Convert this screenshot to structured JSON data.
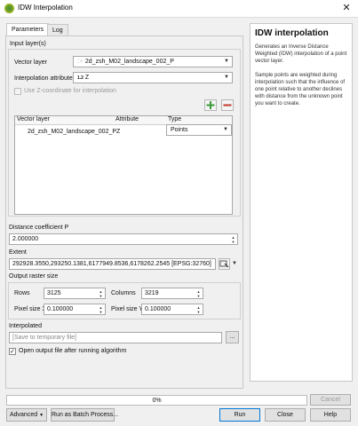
{
  "window": {
    "title": "IDW Interpolation",
    "close_icon": "close-icon"
  },
  "tabs": [
    {
      "label": "Parameters"
    },
    {
      "label": "Log"
    }
  ],
  "input_layers": {
    "group_label": "Input layer(s)",
    "vector_layer_label": "Vector layer",
    "vector_layer_value": "2d_zsh_M02_landscape_002_P",
    "attribute_label": "Interpolation attribute",
    "attribute_type_tag": "1.2",
    "attribute_value": "Z",
    "use_z_label": "Use Z-coordinate for interpolation",
    "table": {
      "headers": [
        "Vector layer",
        "Attribute",
        "Type"
      ],
      "rows": [
        {
          "layer": "2d_zsh_M02_landscape_002_P",
          "attribute": "Z",
          "type": "Points"
        }
      ]
    }
  },
  "distance": {
    "label": "Distance coefficient P",
    "value": "2.000000"
  },
  "extent": {
    "label": "Extent",
    "value": "292928.3550,293250.1381,6177949.8536,6178262.2545 [EPSG:32760]"
  },
  "raster": {
    "label": "Output raster size",
    "rows_label": "Rows",
    "rows_value": "3125",
    "columns_label": "Columns",
    "columns_value": "3219",
    "pixel_x_label": "Pixel size X",
    "pixel_x_value": "0.100000",
    "pixel_y_label": "Pixel size Y",
    "pixel_y_value": "0.100000"
  },
  "output": {
    "label": "Interpolated",
    "placeholder": "[Save to temporary file]",
    "browse_label": "...",
    "open_label": "Open output file after running algorithm"
  },
  "help": {
    "title": "IDW interpolation",
    "p1": "Generates an Inverse Distance Weighted (IDW) interpolation of a point vector layer.",
    "p2": "Sample points are weighted during interpolation such that the influence of one point relative to another declines with distance from the unknown point you want to create."
  },
  "footer": {
    "progress": "0%",
    "progress_fraction": 0,
    "cancel": "Cancel",
    "advanced": "Advanced",
    "batch": "Run as Batch Process...",
    "run": "Run",
    "close": "Close",
    "help": "Help"
  },
  "colors": {
    "add": "#3a9a3a",
    "remove": "#c0392b",
    "accent": "#589632"
  }
}
